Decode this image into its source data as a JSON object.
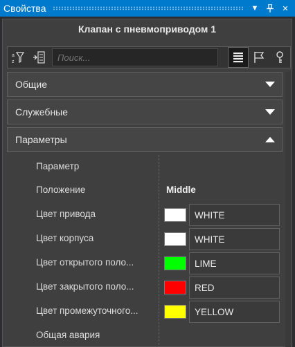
{
  "window": {
    "title": "Свойства"
  },
  "node": {
    "title": "Клапан с пневмоприводом 1"
  },
  "toolbar": {
    "search_placeholder": "Поиск..."
  },
  "sections": [
    {
      "label": "Общие",
      "expanded": false
    },
    {
      "label": "Служебные",
      "expanded": false
    },
    {
      "label": "Параметры",
      "expanded": true
    }
  ],
  "params": [
    {
      "name": "Параметр",
      "value": ""
    },
    {
      "name": "Положение",
      "value": "Middle"
    },
    {
      "name": "Цвет привода",
      "color_name": "WHITE",
      "color": "#ffffff"
    },
    {
      "name": "Цвет корпуса",
      "color_name": "WHITE",
      "color": "#ffffff"
    },
    {
      "name": "Цвет открытого поло...",
      "color_name": "LIME",
      "color": "#00ff00"
    },
    {
      "name": "Цвет закрытого поло...",
      "color_name": "RED",
      "color": "#ff0000"
    },
    {
      "name": "Цвет промежуточного...",
      "color_name": "YELLOW",
      "color": "#ffff00"
    },
    {
      "name": "Общая авария",
      "value": ""
    }
  ],
  "icons": {
    "filter_sort": "filter-sort-icon",
    "collapse": "collapse-icon",
    "list": "list-view-icon",
    "flag": "flag-icon",
    "key": "key-icon"
  },
  "colors": {
    "titlebar": "#007acc",
    "panel": "#3f3f3f",
    "section": "#454545"
  }
}
